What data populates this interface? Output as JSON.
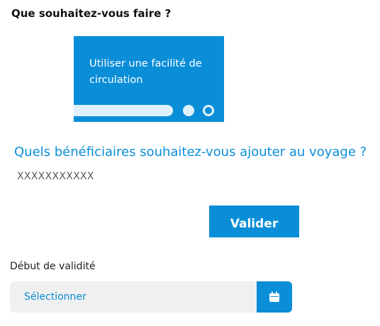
{
  "question": {
    "title": "Que souhaitez-vous faire ?"
  },
  "option_card": {
    "label": "Utiliser une facilité de circulation",
    "icon": "progress-dots"
  },
  "beneficiaries": {
    "title": "Quels bénéficiaires souhaitez-vous ajouter au voyage ?",
    "name": "XXXXXXXXXXX"
  },
  "actions": {
    "validate_label": "Valider"
  },
  "validity": {
    "label": "Début de validité",
    "placeholder": "Sélectionner",
    "calendar_icon": "calendar-icon"
  },
  "colors": {
    "accent": "#0b8ed8",
    "field_bg": "#f0f0f0",
    "card_light": "#dff1fb"
  }
}
